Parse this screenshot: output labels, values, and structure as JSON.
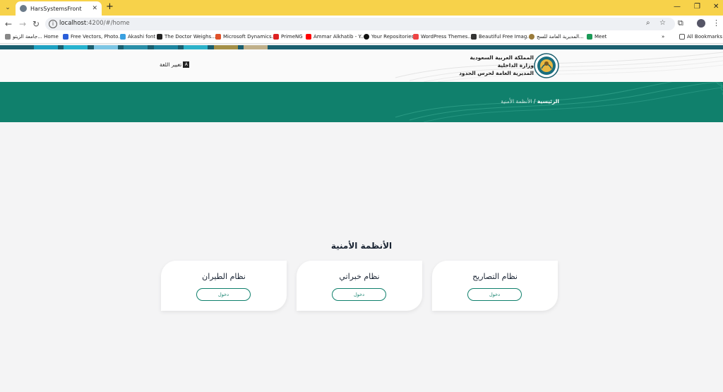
{
  "browser": {
    "tab_title": "HarsSystemsFront",
    "url_host": "localhost",
    "url_path": ":4200/#/home",
    "bookmarks": [
      "جامعة الزيتو... Home",
      "Free Vectors, Photo...",
      "Akashi font",
      "The Doctor Weighs...",
      "Microsoft Dynamics...",
      "PrimeNG",
      "Ammar Alkhatib - Y...",
      "Your Repositories",
      "WordPress Themes...",
      "Beautiful Free Imag...",
      "المديرية العامة للسج...",
      "Meet"
    ],
    "all_bookmarks": "All Bookmarks"
  },
  "header": {
    "org_line1": "المملكة العربية السعودية",
    "org_line2": "وزارة الداخلية",
    "org_line3": "المديرية العامة لحرس الحدود",
    "lang_label": "تغيير اللغة"
  },
  "breadcrumb": {
    "home": "الرئيسية",
    "separator": "/",
    "current": "الأنظمة الأمنية"
  },
  "main": {
    "title": "الأنظمة الأمنية",
    "cards": [
      {
        "title": "نظام الطيران",
        "button": "دخول"
      },
      {
        "title": "نظام خبراتي",
        "button": "دخول"
      },
      {
        "title": "نظام التصاريح",
        "button": "دخول"
      }
    ]
  },
  "colors": {
    "accent": "#10806c",
    "tabbar": "#f7d24a",
    "stripe": "#1a5e6e"
  }
}
